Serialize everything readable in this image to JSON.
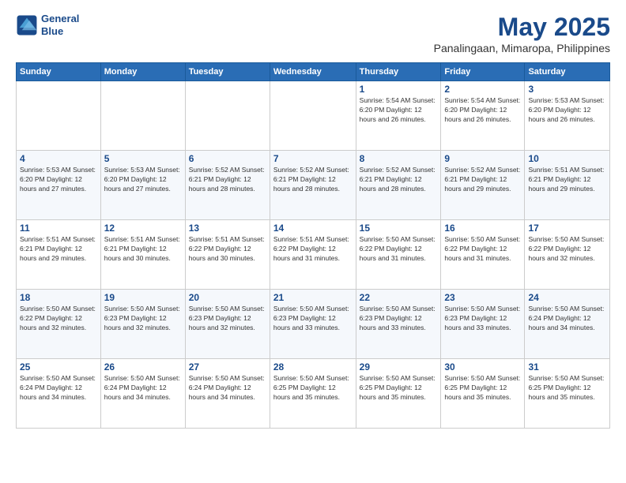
{
  "logo": {
    "line1": "General",
    "line2": "Blue"
  },
  "header": {
    "title": "May 2025",
    "subtitle": "Panalingaan, Mimaropa, Philippines"
  },
  "weekdays": [
    "Sunday",
    "Monday",
    "Tuesday",
    "Wednesday",
    "Thursday",
    "Friday",
    "Saturday"
  ],
  "weeks": [
    [
      {
        "day": "",
        "info": ""
      },
      {
        "day": "",
        "info": ""
      },
      {
        "day": "",
        "info": ""
      },
      {
        "day": "",
        "info": ""
      },
      {
        "day": "1",
        "info": "Sunrise: 5:54 AM\nSunset: 6:20 PM\nDaylight: 12 hours\nand 26 minutes."
      },
      {
        "day": "2",
        "info": "Sunrise: 5:54 AM\nSunset: 6:20 PM\nDaylight: 12 hours\nand 26 minutes."
      },
      {
        "day": "3",
        "info": "Sunrise: 5:53 AM\nSunset: 6:20 PM\nDaylight: 12 hours\nand 26 minutes."
      }
    ],
    [
      {
        "day": "4",
        "info": "Sunrise: 5:53 AM\nSunset: 6:20 PM\nDaylight: 12 hours\nand 27 minutes."
      },
      {
        "day": "5",
        "info": "Sunrise: 5:53 AM\nSunset: 6:20 PM\nDaylight: 12 hours\nand 27 minutes."
      },
      {
        "day": "6",
        "info": "Sunrise: 5:52 AM\nSunset: 6:21 PM\nDaylight: 12 hours\nand 28 minutes."
      },
      {
        "day": "7",
        "info": "Sunrise: 5:52 AM\nSunset: 6:21 PM\nDaylight: 12 hours\nand 28 minutes."
      },
      {
        "day": "8",
        "info": "Sunrise: 5:52 AM\nSunset: 6:21 PM\nDaylight: 12 hours\nand 28 minutes."
      },
      {
        "day": "9",
        "info": "Sunrise: 5:52 AM\nSunset: 6:21 PM\nDaylight: 12 hours\nand 29 minutes."
      },
      {
        "day": "10",
        "info": "Sunrise: 5:51 AM\nSunset: 6:21 PM\nDaylight: 12 hours\nand 29 minutes."
      }
    ],
    [
      {
        "day": "11",
        "info": "Sunrise: 5:51 AM\nSunset: 6:21 PM\nDaylight: 12 hours\nand 29 minutes."
      },
      {
        "day": "12",
        "info": "Sunrise: 5:51 AM\nSunset: 6:21 PM\nDaylight: 12 hours\nand 30 minutes."
      },
      {
        "day": "13",
        "info": "Sunrise: 5:51 AM\nSunset: 6:22 PM\nDaylight: 12 hours\nand 30 minutes."
      },
      {
        "day": "14",
        "info": "Sunrise: 5:51 AM\nSunset: 6:22 PM\nDaylight: 12 hours\nand 31 minutes."
      },
      {
        "day": "15",
        "info": "Sunrise: 5:50 AM\nSunset: 6:22 PM\nDaylight: 12 hours\nand 31 minutes."
      },
      {
        "day": "16",
        "info": "Sunrise: 5:50 AM\nSunset: 6:22 PM\nDaylight: 12 hours\nand 31 minutes."
      },
      {
        "day": "17",
        "info": "Sunrise: 5:50 AM\nSunset: 6:22 PM\nDaylight: 12 hours\nand 32 minutes."
      }
    ],
    [
      {
        "day": "18",
        "info": "Sunrise: 5:50 AM\nSunset: 6:22 PM\nDaylight: 12 hours\nand 32 minutes."
      },
      {
        "day": "19",
        "info": "Sunrise: 5:50 AM\nSunset: 6:23 PM\nDaylight: 12 hours\nand 32 minutes."
      },
      {
        "day": "20",
        "info": "Sunrise: 5:50 AM\nSunset: 6:23 PM\nDaylight: 12 hours\nand 32 minutes."
      },
      {
        "day": "21",
        "info": "Sunrise: 5:50 AM\nSunset: 6:23 PM\nDaylight: 12 hours\nand 33 minutes."
      },
      {
        "day": "22",
        "info": "Sunrise: 5:50 AM\nSunset: 6:23 PM\nDaylight: 12 hours\nand 33 minutes."
      },
      {
        "day": "23",
        "info": "Sunrise: 5:50 AM\nSunset: 6:23 PM\nDaylight: 12 hours\nand 33 minutes."
      },
      {
        "day": "24",
        "info": "Sunrise: 5:50 AM\nSunset: 6:24 PM\nDaylight: 12 hours\nand 34 minutes."
      }
    ],
    [
      {
        "day": "25",
        "info": "Sunrise: 5:50 AM\nSunset: 6:24 PM\nDaylight: 12 hours\nand 34 minutes."
      },
      {
        "day": "26",
        "info": "Sunrise: 5:50 AM\nSunset: 6:24 PM\nDaylight: 12 hours\nand 34 minutes."
      },
      {
        "day": "27",
        "info": "Sunrise: 5:50 AM\nSunset: 6:24 PM\nDaylight: 12 hours\nand 34 minutes."
      },
      {
        "day": "28",
        "info": "Sunrise: 5:50 AM\nSunset: 6:25 PM\nDaylight: 12 hours\nand 35 minutes."
      },
      {
        "day": "29",
        "info": "Sunrise: 5:50 AM\nSunset: 6:25 PM\nDaylight: 12 hours\nand 35 minutes."
      },
      {
        "day": "30",
        "info": "Sunrise: 5:50 AM\nSunset: 6:25 PM\nDaylight: 12 hours\nand 35 minutes."
      },
      {
        "day": "31",
        "info": "Sunrise: 5:50 AM\nSunset: 6:25 PM\nDaylight: 12 hours\nand 35 minutes."
      }
    ]
  ]
}
